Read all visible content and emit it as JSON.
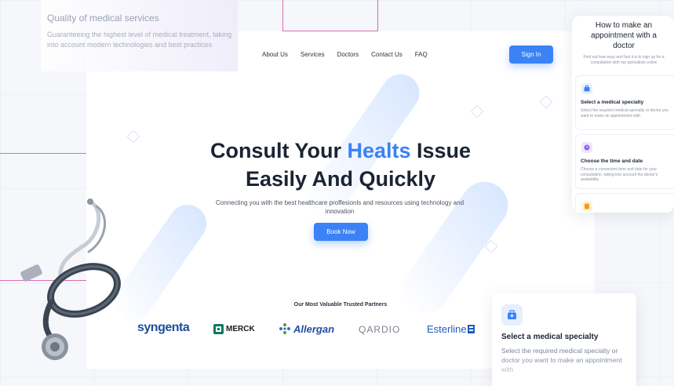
{
  "nav": {
    "items": [
      "About Us",
      "Services",
      "Doctors",
      "Contact Us",
      "FAQ"
    ],
    "signin_label": "Sign In"
  },
  "hero": {
    "title_part1": "Consult Your ",
    "title_accent": "Healts",
    "title_part2": " Issue",
    "title_line2": "Easily And Quickly",
    "subtitle": "Connecting you with the best healthcare proffesionls and resources using technology and innovation",
    "cta_label": "Book Now"
  },
  "partners": {
    "title": "Our Most Valuable Trusted Partners",
    "logos": [
      "syngenta",
      "MERCK",
      "Allergan",
      "QARDIO",
      "Esterline"
    ]
  },
  "quality_card": {
    "title": "Quality of medical services",
    "description": "Guaranteeing the highest level of medical treatment, taking into account modern technologies and best practices"
  },
  "appointment_panel": {
    "title": "How to make an appointment with a doctor",
    "subtitle": "Find out how easy and fast it is to sign up for a consultation with our specialists online",
    "steps": [
      {
        "icon": "briefcase-medical-icon",
        "title": "Select a medical specialty",
        "description": "Select the required medical specialty or doctor you want to make an appointment with"
      },
      {
        "icon": "clock-icon",
        "title": "Choose the time and date",
        "description": "Choose a convenient time and date for your consultation, taking into account the doctor's availability"
      },
      {
        "icon": "document-icon",
        "title": "",
        "description": ""
      }
    ]
  },
  "specialty_card": {
    "title": "Select a medical specialty",
    "description": "Select the required medical specialty or doctor you want to make an appointment with"
  },
  "colors": {
    "accent": "#3b82f6",
    "heading": "#1b2432",
    "purple_icon": "#8b5cf6",
    "orange_icon": "#f59e0b",
    "pink_outline": "#d86fb0"
  }
}
